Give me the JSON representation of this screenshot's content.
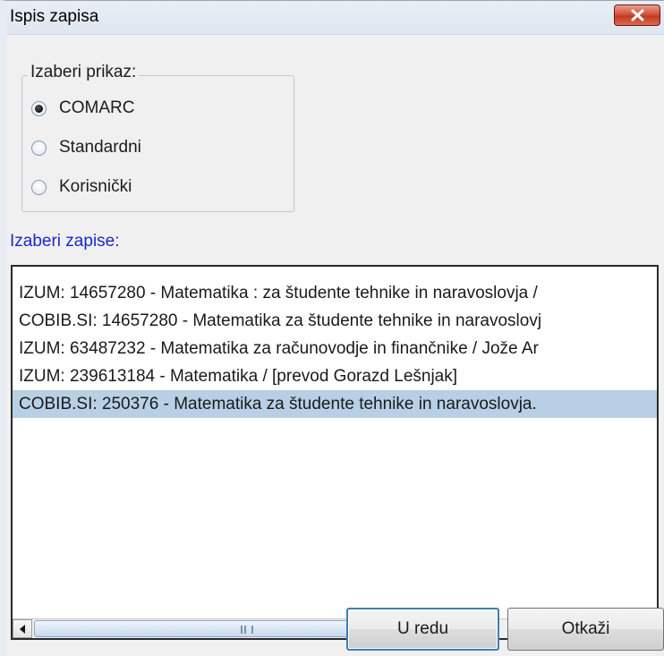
{
  "dialog": {
    "title": "Ispis zapisa",
    "close_icon": "close-x-icon",
    "close_color": "#c43a22"
  },
  "display_group": {
    "legend": "Izaberi prikaz:",
    "options": [
      {
        "label": "COMARC",
        "selected": true
      },
      {
        "label": "Standardni",
        "selected": false
      },
      {
        "label": "Korisnički",
        "selected": false
      }
    ]
  },
  "records": {
    "label": "Izaberi zapise:",
    "label_color": "#1a28cc",
    "items": [
      "IZUM: 14657280 - Matematika : za študente tehnike in naravoslovja /",
      "COBIB.SI: 14657280 - Matematika za študente tehnike in naravoslovj",
      "IZUM: 63487232 - Matematika za računovodje in finančnike / Jože Ar",
      "IZUM: 239613184 - Matematika / [prevod Gorazd Lešnjak]",
      "COBIB.SI: 250376 - Matematika za študente tehnike in naravoslovja."
    ],
    "selected_index": 4,
    "selection_color": "#b8cfe5"
  },
  "scrollbar": {
    "left_icon": "arrow-left-icon",
    "right_icon": "arrow-right-icon",
    "grip_icon": "scroll-grip-icon"
  },
  "buttons": {
    "ok_label": "U redu",
    "cancel_label": "Otkaži"
  }
}
